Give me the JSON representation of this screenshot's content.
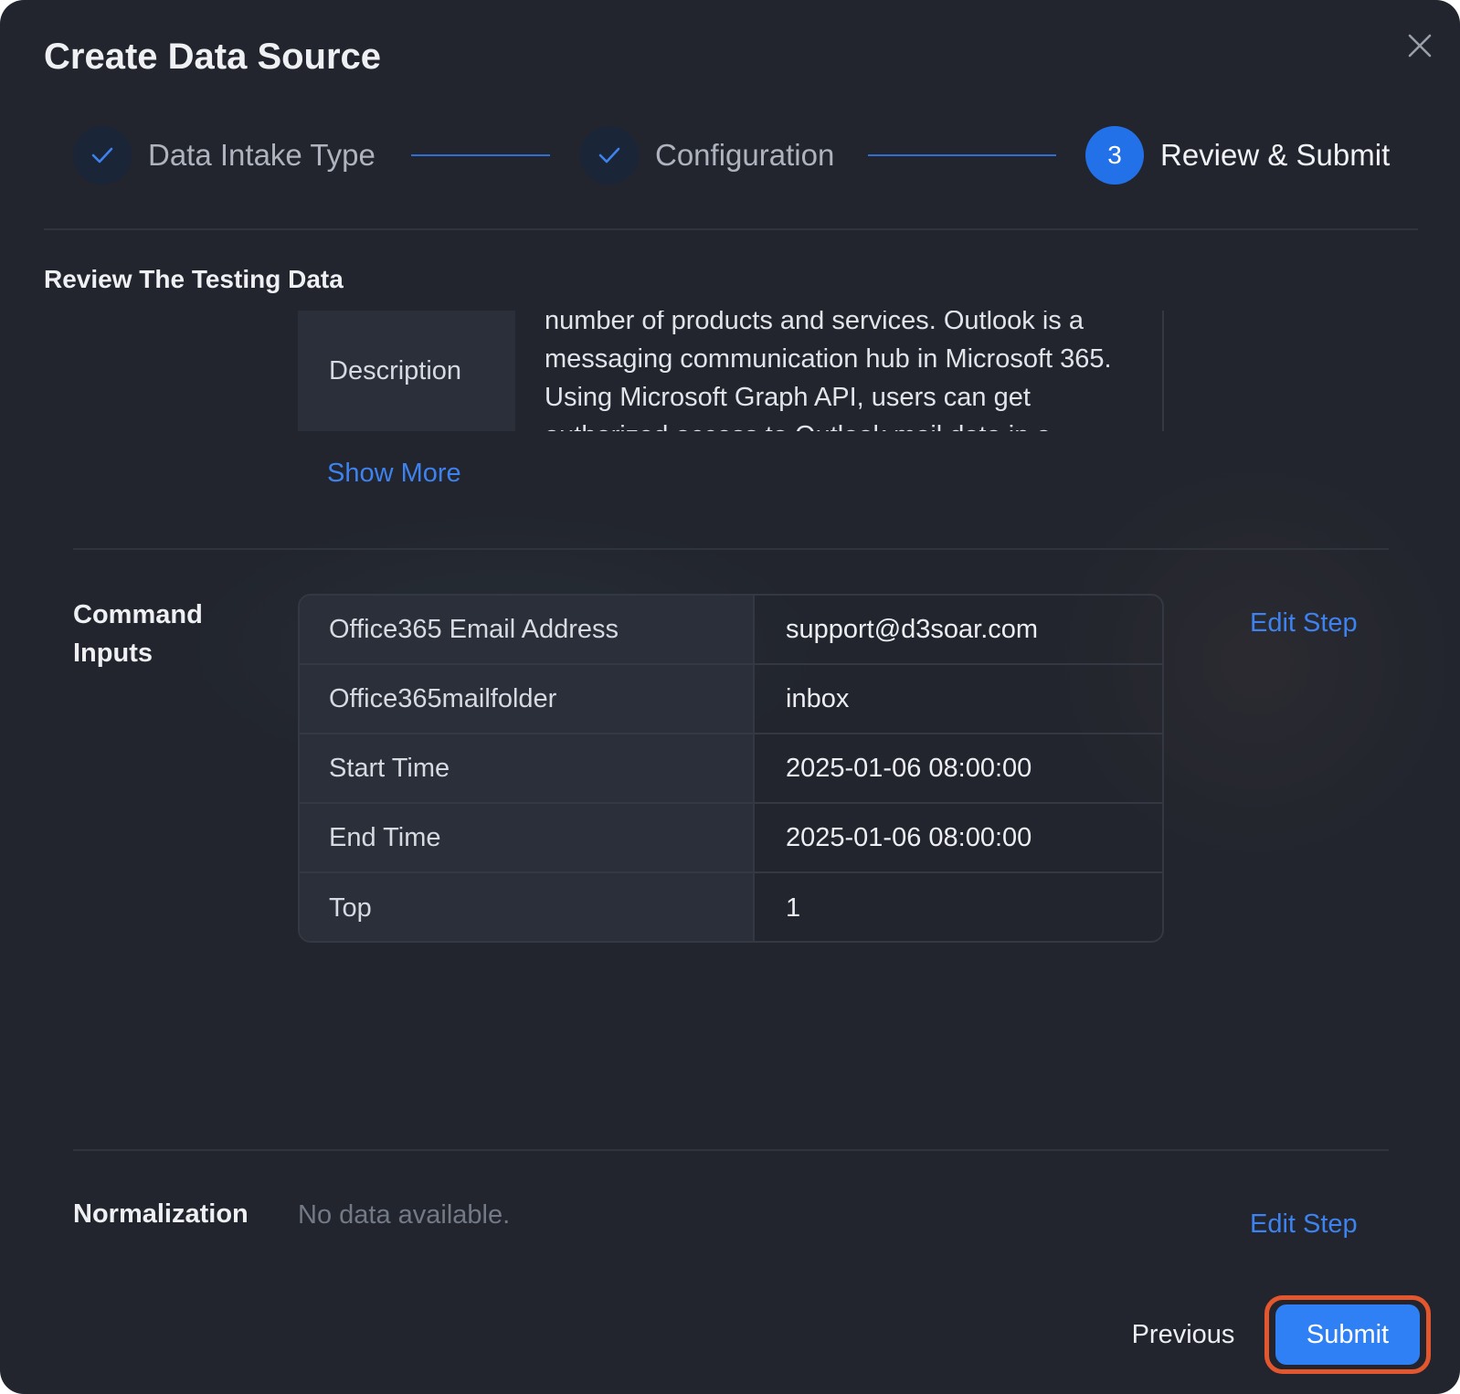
{
  "modal": {
    "title": "Create Data Source"
  },
  "stepper": {
    "steps": [
      {
        "label": "Data Intake Type",
        "state": "done",
        "icon": "check-icon"
      },
      {
        "label": "Configuration",
        "state": "done",
        "icon": "check-icon"
      },
      {
        "label": "Review & Submit",
        "state": "active",
        "number": "3"
      }
    ]
  },
  "review": {
    "heading": "Review The Testing Data",
    "description_key": "Description",
    "description_value": "number of products and services. Outlook is a messaging communication hub in Microsoft 365. Using Microsoft Graph API, users can get authorized access to Outlook mail data in a",
    "show_more": "Show More"
  },
  "command_inputs": {
    "label": "Command Inputs",
    "edit": "Edit Step",
    "rows": [
      {
        "key": "Office365 Email Address",
        "value": "support@d3soar.com"
      },
      {
        "key": "Office365mailfolder",
        "value": "inbox"
      },
      {
        "key": "Start Time",
        "value": "2025-01-06 08:00:00"
      },
      {
        "key": "End Time",
        "value": "2025-01-06 08:00:00"
      },
      {
        "key": "Top",
        "value": "1"
      }
    ]
  },
  "normalization": {
    "label": "Normalization",
    "empty": "No data available.",
    "edit": "Edit Step"
  },
  "footer": {
    "previous": "Previous",
    "submit": "Submit"
  },
  "colors": {
    "background": "#22252e",
    "accent": "#2f80f5",
    "link": "#3d82ee",
    "highlight": "#e4572e"
  }
}
